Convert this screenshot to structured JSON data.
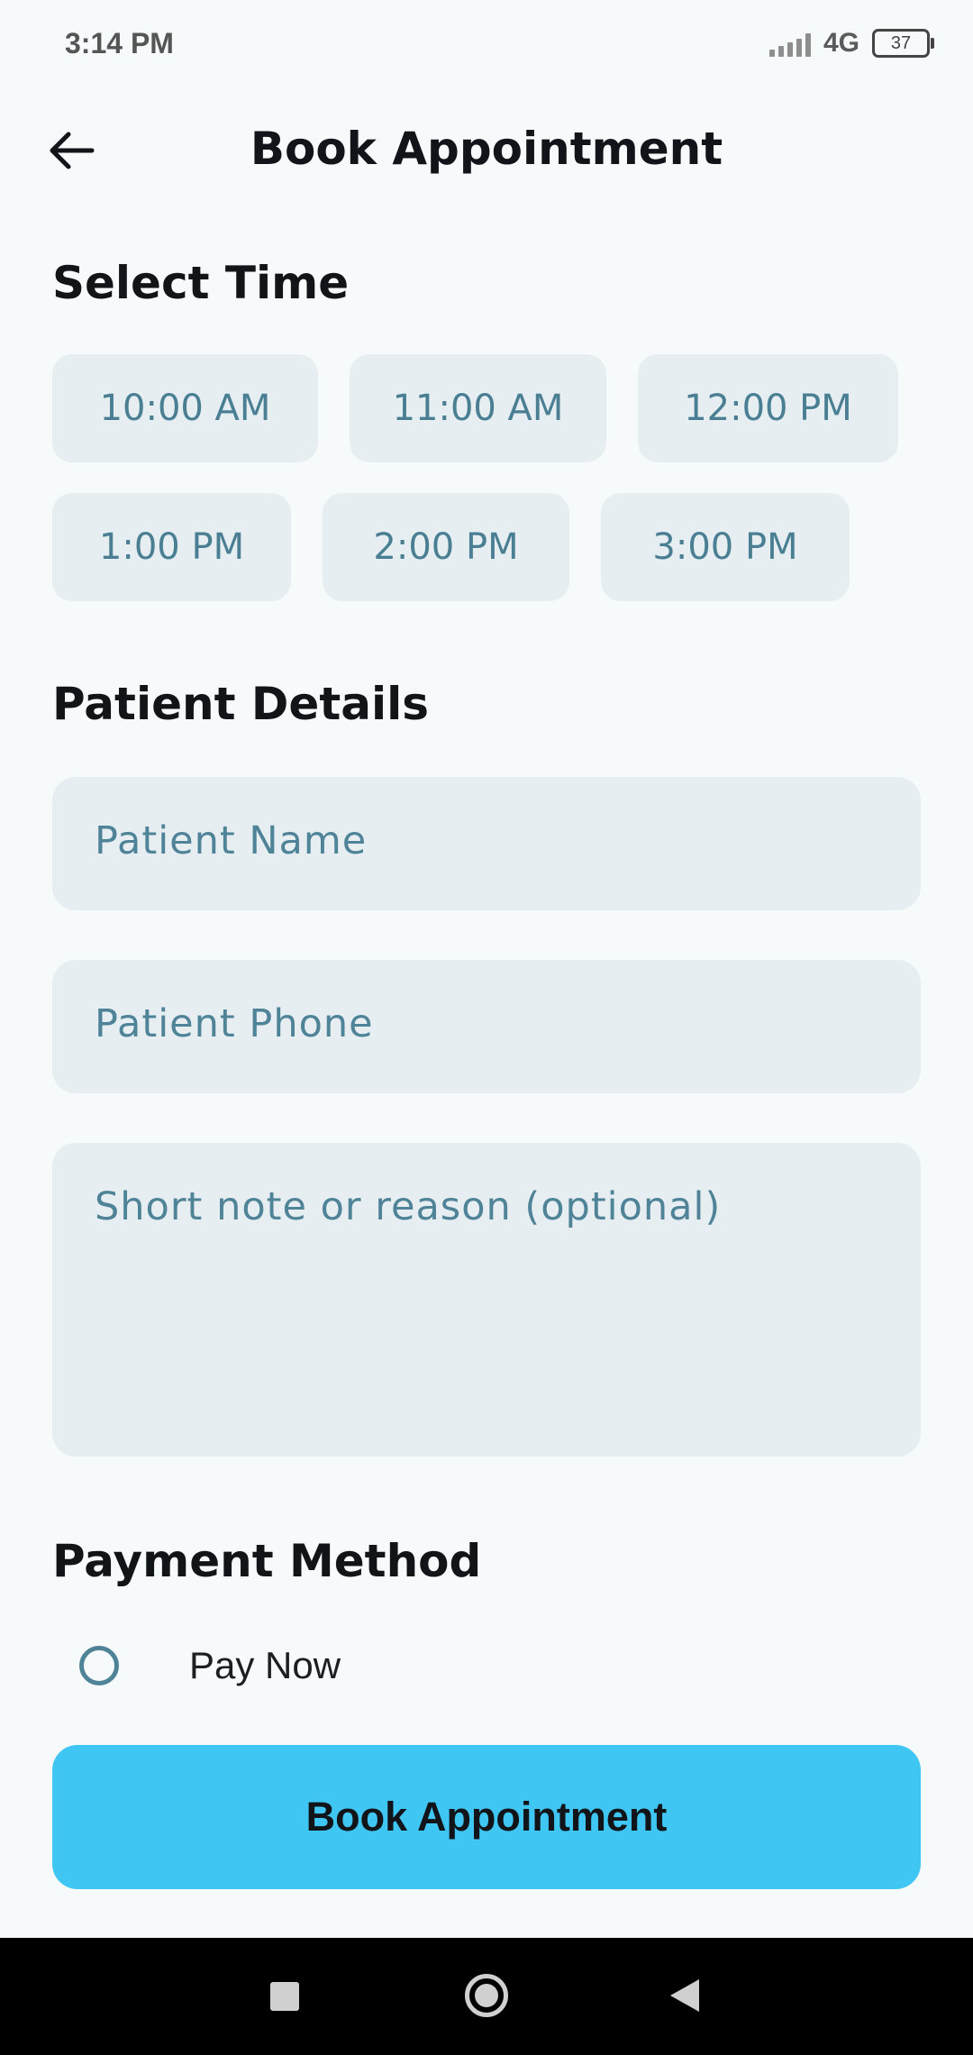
{
  "status_bar": {
    "time": "3:14 PM",
    "network": "4G",
    "battery": "37"
  },
  "app_bar": {
    "title": "Book Appointment",
    "back_icon": "arrow-left-icon"
  },
  "time_section": {
    "title": "Select Time",
    "slots": [
      "10:00 AM",
      "11:00 AM",
      "12:00 PM",
      "1:00 PM",
      "2:00 PM",
      "3:00 PM"
    ]
  },
  "patient_section": {
    "title": "Patient Details",
    "name_placeholder": "Patient Name",
    "phone_placeholder": "Patient Phone",
    "note_placeholder": "Short note or reason (optional)"
  },
  "payment_section": {
    "title": "Payment Method",
    "options": [
      {
        "label": "Pay Now",
        "selected": false
      }
    ]
  },
  "submit": {
    "label": "Book Appointment"
  },
  "colors": {
    "accent": "#3fc6f2",
    "chip_bg": "#e6eef2",
    "hint_text": "#4f8397",
    "background": "#f6fafb"
  }
}
